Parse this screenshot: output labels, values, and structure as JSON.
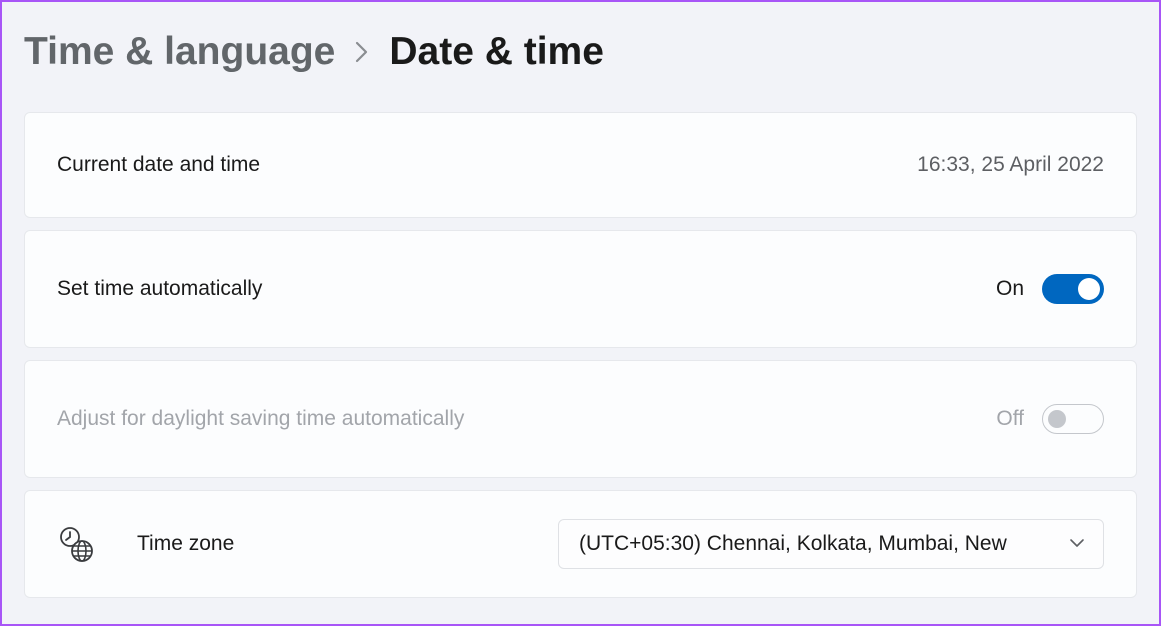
{
  "breadcrumb": {
    "parent": "Time & language",
    "current": "Date & time"
  },
  "currentDateTime": {
    "label": "Current date and time",
    "value": "16:33, 25 April 2022"
  },
  "setTimeAuto": {
    "label": "Set time automatically",
    "state": "On"
  },
  "dstAuto": {
    "label": "Adjust for daylight saving time automatically",
    "state": "Off"
  },
  "timeZone": {
    "label": "Time zone",
    "value": "(UTC+05:30) Chennai, Kolkata, Mumbai, New"
  }
}
